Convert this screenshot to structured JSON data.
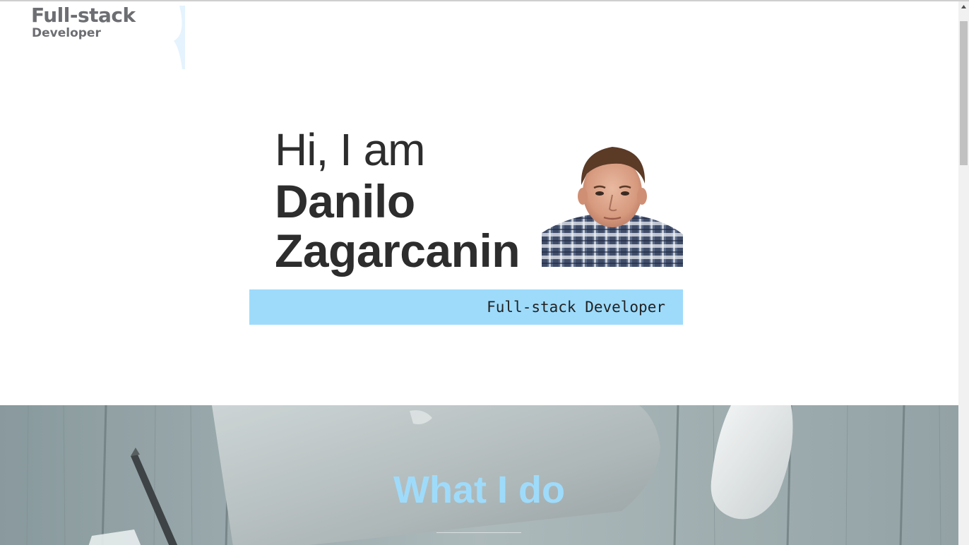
{
  "logo": {
    "title": "Full-stack",
    "subtitle": "Developer"
  },
  "hero": {
    "greeting": "Hi, I am",
    "first_name": "Danilo",
    "last_name": "Zagarcanin",
    "role": "Full-stack Developer",
    "avatar_icon": "profile-photo"
  },
  "what_i_do": {
    "title": "What I do"
  },
  "colors": {
    "accent": "#9edbfb",
    "text_dark": "#2d2d2d",
    "logo_gray": "#6d6e72"
  },
  "scrollbar": {
    "position_fraction": 0.0
  }
}
